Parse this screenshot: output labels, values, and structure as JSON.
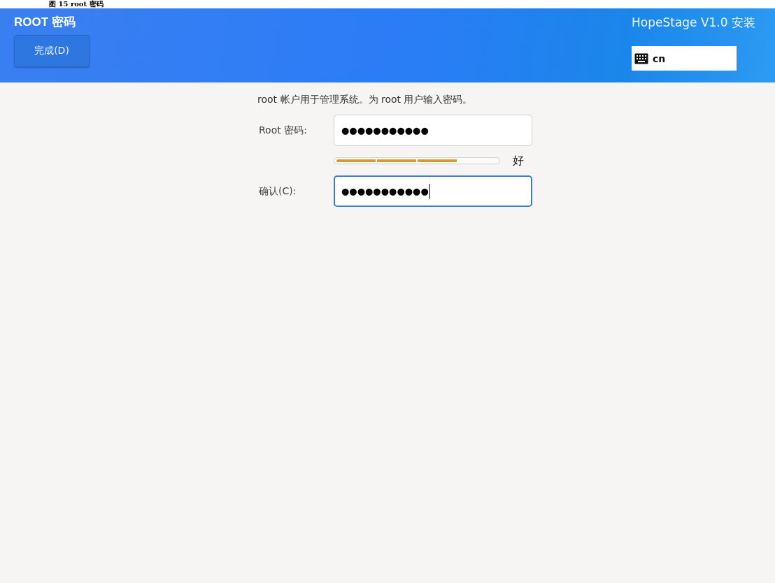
{
  "caption": "图 15 root 密码",
  "header": {
    "title": "ROOT 密码",
    "done_button": "完成(D)",
    "product_title": "HopeStage V1.0 安装",
    "keyboard_layout": "cn"
  },
  "description": "root 帐户用于管理系统。为 root 用户输入密码。",
  "fields": [
    {
      "label": "Root 密码:",
      "value": "●●●●●●●●●●●",
      "focused": false
    },
    {
      "label": "确认(C):",
      "value": "●●●●●●●●●●●",
      "focused": true
    }
  ],
  "strength": {
    "level": 0.75,
    "label": "好"
  }
}
